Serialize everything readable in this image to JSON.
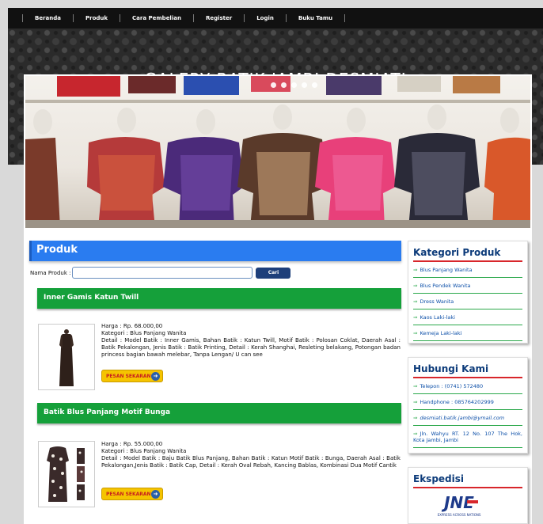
{
  "nav": {
    "items": [
      "Beranda",
      "Produk",
      "Cara Pembelian",
      "Register",
      "Login",
      "Buku Tamu"
    ]
  },
  "header": {
    "title": "GALERY BATIK JAMBI DESMIATI"
  },
  "main": {
    "section_title": "Produk",
    "search": {
      "label": "Nama Produk :",
      "value": "",
      "button": "Cari"
    },
    "products": [
      {
        "name": "Inner Gamis Katun Twill",
        "price": "Harga : Rp. 68.000,00",
        "category": "Kategori : Blus Panjang Wanita",
        "detail": "Detail : Model Batik : Inner Gamis, Bahan Batik : Katun Twill, Motif Batik : Polosan Coklat, Daerah Asal : Batik Pekalongan, Jenis Batik : Batik Printing, Detail : Kerah Shanghai, Resleting belakang, Potongan badan princess bagian bawah melebar, Tanpa Lengan/ U can see",
        "order_label": "PESAN SEKARANG"
      },
      {
        "name": "Batik Blus Panjang Motif Bunga",
        "price": "Harga : Rp. 55.000,00",
        "category": "Kategori : Blus Panjang Wanita",
        "detail": "Detail : Model Batik : Baju Batik Blus Panjang, Bahan Batik : Katun Motif Batik : Bunga, Daerah Asal : Batik Pekalongan,Jenis Batik : Batik Cap, Detail : Kerah Oval Rebah, Kancing Bablas, Kombinasi Dua Motif Cantik",
        "order_label": "PESAN SEKARANG"
      }
    ]
  },
  "sidebar": {
    "kategori": {
      "title": "Kategori Produk",
      "items": [
        "Blus Panjang Wanita",
        "Blus Pendek Wanita",
        "Dress Wanita",
        "Kaos Laki-laki",
        "Kemeja Laki-laki"
      ]
    },
    "hubungi": {
      "title": "Hubungi Kami",
      "items": [
        "Telepon : (0741) 572480",
        "Handphone : 085764202999",
        "desmiati.batik.jambi@ymail.com",
        "Jln. Wahyu RT. 12 No. 107 The Hok, Kota Jambi, Jambi"
      ]
    },
    "ekspedisi": {
      "title": "Ekspedisi",
      "logo_text": "JNE",
      "logo_tagline": "EXPRESS ACROSS NATIONS"
    }
  },
  "colors": {
    "produk_bar": "#2a7cf0",
    "product_bar": "#15a03a",
    "sidebar_title": "#0c3b7a",
    "sidebar_rule": "#d8262b",
    "order_button": "#f5c400"
  }
}
